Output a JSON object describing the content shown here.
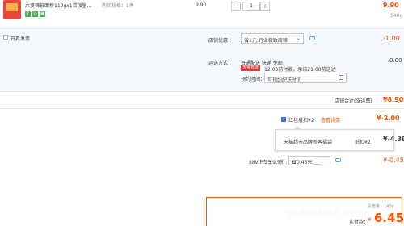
{
  "item": {
    "title": "六婆辣椒面粉110gx1袋加量...",
    "spec_label": "购买规格：1件",
    "unit_price": "9.90",
    "quantity": "1",
    "subtotal": "9.90",
    "weight": "140g",
    "minus": "−",
    "plus": "+"
  },
  "invoice": {
    "label": "开具发票"
  },
  "shop_discount": {
    "label": "店铺优惠：",
    "selected": "省1元:行业极致周辣",
    "amount": "-1.00"
  },
  "delivery": {
    "label": "运送方式：",
    "methods": "普通配送 快递 免邮",
    "badge": "天猫直送",
    "eta": "12:00前付款，承诺21:00前送达",
    "time_label": "预约时间：",
    "time_placeholder": "可预约配送时间",
    "amount": "0.00"
  },
  "shop_total": {
    "label": "店铺合计(含运费)",
    "value": "¥8.90"
  },
  "redpacket": {
    "label": "红包抵扣¥2",
    "link": "查看详情",
    "amount": "¥-2.00",
    "popup_text": "天猫超市品牌新客福袋",
    "popup_value": "抵扣¥2"
  },
  "vip": {
    "label": "88VIP专享9.5折：",
    "value": "省0.45元",
    "amount": "¥-0.45"
  },
  "other_discount": {
    "amount": "¥-4.38"
  },
  "summary": {
    "weight": "总重量：140g",
    "paid_label": "实付款：",
    "currency": "¥",
    "paid": "6.45"
  },
  "watermark": {
    "text": "值 什么值得买",
    "url": "zhizhizhi.com"
  },
  "colors": {
    "accent": "#ff5000",
    "blue": "#3b6ee0",
    "border": "#e3e8f0"
  }
}
